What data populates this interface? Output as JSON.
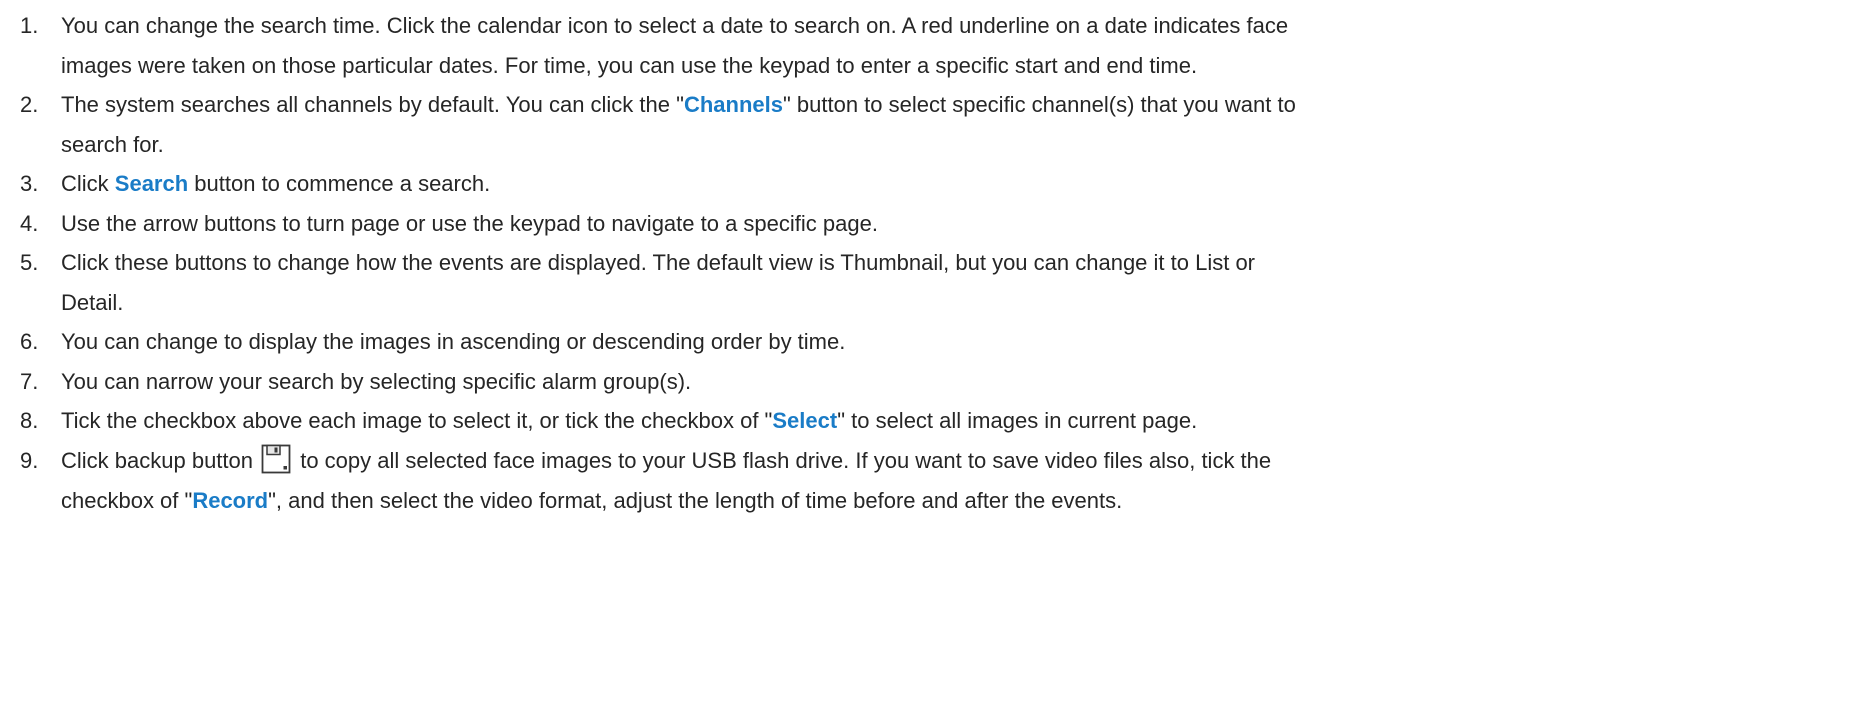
{
  "steps": [
    {
      "number": "1.",
      "line1": "You can change the search time. Click the calendar icon to select a date to search on. A red underline on a date indicates face",
      "line2": "images were taken on those particular dates. For time, you can use the keypad to enter a specific start and end time."
    },
    {
      "number": "2.",
      "line1_a": "The system searches all channels by default. You can click the \"",
      "line1_kw": "Channels",
      "line1_b": "\" button to select specific channel(s) that you want to",
      "line2": "search for."
    },
    {
      "number": "3.",
      "a": "Click ",
      "kw": "Search",
      "b": " button to commence a search."
    },
    {
      "number": "4.",
      "text": "Use the arrow buttons to turn page or use the keypad to navigate to a specific page."
    },
    {
      "number": "5.",
      "line1": "Click these buttons to change how the events are displayed. The default view is Thumbnail, but you can change it to List or",
      "line2": "Detail."
    },
    {
      "number": "6.",
      "text": "You can change to display the images in ascending or descending order by time."
    },
    {
      "number": "7.",
      "text": "You can narrow your search by selecting specific alarm group(s)."
    },
    {
      "number": "8.",
      "a": "Tick the checkbox above each image to select it, or tick the checkbox of \"",
      "kw": "Select",
      "b": "\" to select all images in current page."
    },
    {
      "number": "9.",
      "line1_a": "Click backup button ",
      "line1_icon": "save-icon",
      "line1_b": " to copy all selected face images to your USB flash drive. If you want to save video files also, tick the",
      "line2_a": "checkbox of \"",
      "line2_kw": "Record",
      "line2_b": "\", and then select the video format, adjust the length of time before and after the events."
    }
  ],
  "colors": {
    "text": "#262626",
    "keyword": "#1a7cc7"
  }
}
